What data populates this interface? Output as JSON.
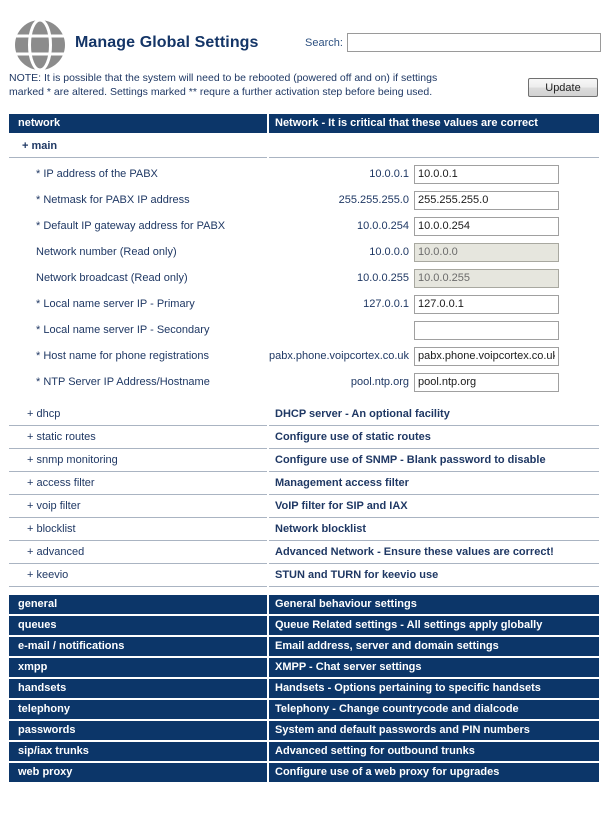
{
  "header": {
    "title": "Manage Global Settings",
    "logo_icon": "globe-icon",
    "search_label": "Search:",
    "search_value": "",
    "search_placeholder": ""
  },
  "note": {
    "text": "NOTE: It is possible that the system will need to be rebooted (powered off and on) if settings marked * are altered. Settings marked ** requre a further activation step before being used."
  },
  "toolbar": {
    "update_label": "Update"
  },
  "colors": {
    "category_bar": "#0c3669",
    "text_blue": "#1f3864",
    "readonly_field": "#e6e6de"
  },
  "network_section": {
    "key": "network",
    "description": "Network - It is critical that these values are correct",
    "main_group": {
      "label": "+ main",
      "fields": [
        {
          "label": "* IP address of the PABX",
          "value": "10.0.0.1",
          "input": "10.0.0.1",
          "readonly": false
        },
        {
          "label": "* Netmask for PABX IP address",
          "value": "255.255.255.0",
          "input": "255.255.255.0",
          "readonly": false
        },
        {
          "label": "* Default IP gateway address for PABX",
          "value": "10.0.0.254",
          "input": "10.0.0.254",
          "readonly": false
        },
        {
          "label": "Network number (Read only)",
          "value": "10.0.0.0",
          "input": "10.0.0.0",
          "readonly": true
        },
        {
          "label": "Network broadcast (Read only)",
          "value": "10.0.0.255",
          "input": "10.0.0.255",
          "readonly": true
        },
        {
          "label": "* Local name server IP - Primary",
          "value": "127.0.0.1",
          "input": "127.0.0.1",
          "readonly": false
        },
        {
          "label": "* Local name server IP - Secondary",
          "value": "",
          "input": "",
          "readonly": false
        },
        {
          "label": "* Host name for phone registrations",
          "value": "pabx.phone.voipcortex.co.uk",
          "input": "pabx.phone.voipcortex.co.uk",
          "readonly": false
        },
        {
          "label": "* NTP Server IP Address/Hostname",
          "value": "pool.ntp.org",
          "input": "pool.ntp.org",
          "readonly": false
        }
      ]
    },
    "subsections": [
      {
        "label": "+ dhcp",
        "description": "DHCP server - An optional facility"
      },
      {
        "label": "+ static routes",
        "description": "Configure use of static routes"
      },
      {
        "label": "+ snmp monitoring",
        "description": "Configure use of SNMP - Blank password to disable"
      },
      {
        "label": "+ access filter",
        "description": "Management access filter"
      },
      {
        "label": "+ voip filter",
        "description": "VoIP filter for SIP and IAX"
      },
      {
        "label": "+ blocklist",
        "description": "Network blocklist"
      },
      {
        "label": "+ advanced",
        "description": "Advanced Network - Ensure these values are correct!"
      },
      {
        "label": "+ keevio",
        "description": "STUN and TURN for keevio use"
      }
    ]
  },
  "categories": [
    {
      "key": "general",
      "description": "General behaviour settings"
    },
    {
      "key": "queues",
      "description": "Queue Related settings - All settings apply globally"
    },
    {
      "key": "e-mail / notifications",
      "description": "Email address, server and domain settings"
    },
    {
      "key": "xmpp",
      "description": "XMPP - Chat server settings"
    },
    {
      "key": "handsets",
      "description": "Handsets - Options pertaining to specific handsets"
    },
    {
      "key": "telephony",
      "description": "Telephony - Change countrycode and dialcode"
    },
    {
      "key": "passwords",
      "description": "System and default passwords and PIN numbers"
    },
    {
      "key": "sip/iax trunks",
      "description": "Advanced setting for outbound trunks"
    },
    {
      "key": "web proxy",
      "description": "Configure use of a web proxy for upgrades"
    }
  ]
}
